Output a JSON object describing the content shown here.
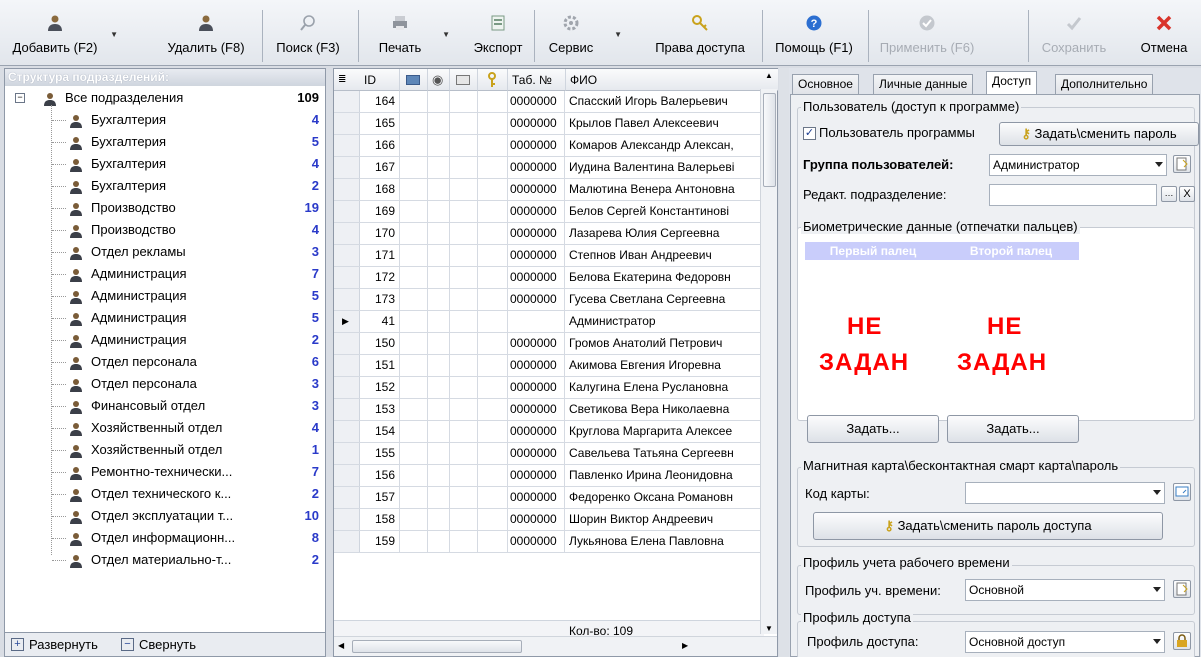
{
  "toolbar": {
    "add": "Добавить (F2)",
    "delete": "Удалить (F8)",
    "search": "Поиск (F3)",
    "print": "Печать",
    "export": "Экспорт",
    "service": "Сервис",
    "access_rights": "Права доступа",
    "help": "Помощь (F1)",
    "apply": "Применить (F6)",
    "save": "Сохранить",
    "cancel": "Отмена"
  },
  "tree": {
    "title": "Структура подразделений:",
    "root": {
      "label": "Все подразделения",
      "count": "109"
    },
    "items": [
      {
        "label": "Бухгалтерия",
        "count": "4"
      },
      {
        "label": "Бухгалтерия",
        "count": "5"
      },
      {
        "label": "Бухгалтерия",
        "count": "4"
      },
      {
        "label": "Бухгалтерия",
        "count": "2"
      },
      {
        "label": "Производство",
        "count": "19"
      },
      {
        "label": "Производство",
        "count": "4"
      },
      {
        "label": "Отдел рекламы",
        "count": "3"
      },
      {
        "label": "Администрация",
        "count": "7"
      },
      {
        "label": "Администрация",
        "count": "5"
      },
      {
        "label": "Администрация",
        "count": "5"
      },
      {
        "label": "Администрация",
        "count": "2"
      },
      {
        "label": "Отдел персонала",
        "count": "6"
      },
      {
        "label": "Отдел персонала",
        "count": "3"
      },
      {
        "label": "Финансовый отдел",
        "count": "3"
      },
      {
        "label": "Хозяйственный отдел",
        "count": "4"
      },
      {
        "label": "Хозяйственный отдел",
        "count": "1"
      },
      {
        "label": "Ремонтно-технически...",
        "count": "7"
      },
      {
        "label": "Отдел технического к...",
        "count": "2"
      },
      {
        "label": "Отдел эксплуатации т...",
        "count": "10"
      },
      {
        "label": "Отдел информационн...",
        "count": "8"
      },
      {
        "label": "Отдел материально-т...",
        "count": "2"
      }
    ],
    "expand": "Развернуть",
    "collapse": "Свернуть"
  },
  "grid": {
    "col_id": "ID",
    "col_tab": "Таб. №",
    "col_fio": "ФИО",
    "rows": [
      {
        "id": "164",
        "tab": "0000000",
        "fio": "Спасский Игорь Валерьевич"
      },
      {
        "id": "165",
        "tab": "0000000",
        "fio": "Крылов Павел Алексеевич"
      },
      {
        "id": "166",
        "tab": "0000000",
        "fio": "Комаров Александр Алексан,"
      },
      {
        "id": "167",
        "tab": "0000000",
        "fio": "Иудина Валентина Валерьевi"
      },
      {
        "id": "168",
        "tab": "0000000",
        "fio": "Малютина Венера Антоновна"
      },
      {
        "id": "169",
        "tab": "0000000",
        "fio": "Белов Сергей Константинові"
      },
      {
        "id": "170",
        "tab": "0000000",
        "fio": "Лазарева Юлия Сергеевна"
      },
      {
        "id": "171",
        "tab": "0000000",
        "fio": "Степнов Иван Андреевич"
      },
      {
        "id": "172",
        "tab": "0000000",
        "fio": "Белова Екатерина Федоровн"
      },
      {
        "id": "173",
        "tab": "0000000",
        "fio": "Гусева Светлана Сергеевна"
      },
      {
        "id": "41",
        "tab": "",
        "fio": "Администратор"
      },
      {
        "id": "150",
        "tab": "0000000",
        "fio": "Громов Анатолий Петрович"
      },
      {
        "id": "151",
        "tab": "0000000",
        "fio": "Акимова Евгения Игоревна"
      },
      {
        "id": "152",
        "tab": "0000000",
        "fio": "Калугина Елена Руслановна"
      },
      {
        "id": "153",
        "tab": "0000000",
        "fio": "Светикова Вера Николаевна"
      },
      {
        "id": "154",
        "tab": "0000000",
        "fio": "Круглова Маргарита Алексее"
      },
      {
        "id": "155",
        "tab": "0000000",
        "fio": "Савельева Татьяна Сергеевн"
      },
      {
        "id": "156",
        "tab": "0000000",
        "fio": "Павленко Ирина Леонидовна"
      },
      {
        "id": "157",
        "tab": "0000000",
        "fio": "Федоренко Оксана Романовн"
      },
      {
        "id": "158",
        "tab": "0000000",
        "fio": "Шорин Виктор Андреевич"
      },
      {
        "id": "159",
        "tab": "0000000",
        "fio": "Лукьянова Елена Павловна"
      }
    ],
    "footer": "Кол-во: 109"
  },
  "tabs": [
    "Основное",
    "Личные данные",
    "Доступ",
    "Дополнительно"
  ],
  "access": {
    "user_group_title": "Пользователь (доступ к программе)",
    "user_checkbox": "Пользователь программы",
    "set_password": "Задать\\сменить пароль",
    "group_label": "Группа пользователей:",
    "group_value": "Администратор",
    "edit_dept_label": "Редакт. подразделение:",
    "bio_title": "Биометрические данные (отпечатки пальцев)",
    "finger1": "Первый палец",
    "finger2": "Второй палец",
    "not_set_1": "НЕ",
    "not_set_2": "ЗАДАН",
    "set_btn": "Задать...",
    "card_title": "Магнитная карта\\бесконтактная смарт карта\\пароль",
    "card_label": "Код карты:",
    "set_access_password": "Задать\\сменить пароль доступа",
    "worktime_title": "Профиль учета рабочего времени",
    "worktime_label": "Профиль уч. времени:",
    "worktime_value": "Основной",
    "access_profile_title": "Профиль доступа",
    "access_profile_label": "Профиль доступа:",
    "access_profile_value": "Основной доступ"
  },
  "colors": {
    "accent": "#2a3ac9",
    "not_set": "#ff0000"
  }
}
